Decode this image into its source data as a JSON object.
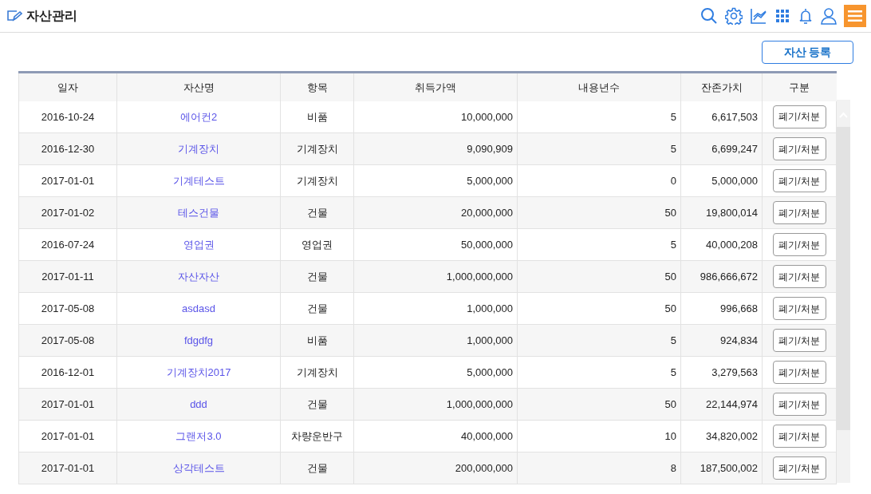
{
  "header": {
    "title": "자산관리"
  },
  "register_button": "자산 등록",
  "table": {
    "columns": [
      "일자",
      "자산명",
      "항목",
      "취득가액",
      "내용년수",
      "잔존가치",
      "구분"
    ],
    "rows": [
      {
        "date": "2016-10-24",
        "name": "에어컨2",
        "category": "비품",
        "cost": "10,000,000",
        "years": "5",
        "residual": "6,617,503",
        "action": "폐기/처분"
      },
      {
        "date": "2016-12-30",
        "name": "기계장치",
        "category": "기계장치",
        "cost": "9,090,909",
        "years": "5",
        "residual": "6,699,247",
        "action": "폐기/처분"
      },
      {
        "date": "2017-01-01",
        "name": "기계테스트",
        "category": "기계장치",
        "cost": "5,000,000",
        "years": "0",
        "residual": "5,000,000",
        "action": "폐기/처분"
      },
      {
        "date": "2017-01-02",
        "name": "테스건물",
        "category": "건물",
        "cost": "20,000,000",
        "years": "50",
        "residual": "19,800,014",
        "action": "폐기/처분"
      },
      {
        "date": "2016-07-24",
        "name": "영업권",
        "category": "영업권",
        "cost": "50,000,000",
        "years": "5",
        "residual": "40,000,208",
        "action": "폐기/처분"
      },
      {
        "date": "2017-01-11",
        "name": "자산자산",
        "category": "건물",
        "cost": "1,000,000,000",
        "years": "50",
        "residual": "986,666,672",
        "action": "폐기/처분"
      },
      {
        "date": "2017-05-08",
        "name": "asdasd",
        "category": "건물",
        "cost": "1,000,000",
        "years": "50",
        "residual": "996,668",
        "action": "폐기/처분"
      },
      {
        "date": "2017-05-08",
        "name": "fdgdfg",
        "category": "비품",
        "cost": "1,000,000",
        "years": "5",
        "residual": "924,834",
        "action": "폐기/처분"
      },
      {
        "date": "2016-12-01",
        "name": "기계장치2017",
        "category": "기계장치",
        "cost": "5,000,000",
        "years": "5",
        "residual": "3,279,563",
        "action": "폐기/처분"
      },
      {
        "date": "2017-01-01",
        "name": "ddd",
        "category": "건물",
        "cost": "1,000,000,000",
        "years": "50",
        "residual": "22,144,974",
        "action": "폐기/처분"
      },
      {
        "date": "2017-01-01",
        "name": "그랜저3.0",
        "category": "차량운반구",
        "cost": "40,000,000",
        "years": "10",
        "residual": "34,820,002",
        "action": "폐기/처분"
      },
      {
        "date": "2017-01-01",
        "name": "상각테스트",
        "category": "건물",
        "cost": "200,000,000",
        "years": "8",
        "residual": "187,500,002",
        "action": "폐기/처분"
      }
    ]
  }
}
